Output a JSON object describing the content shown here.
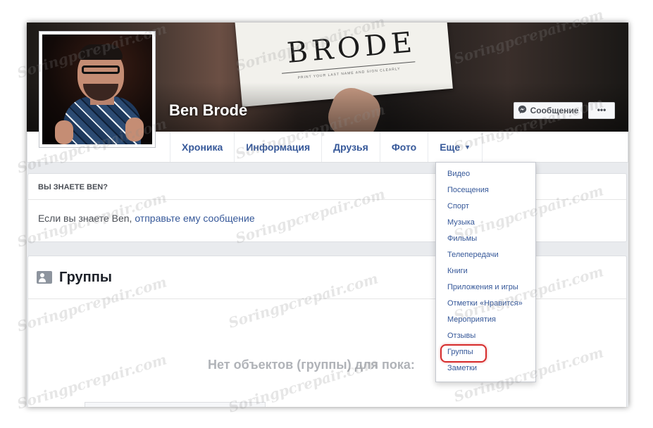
{
  "cover": {
    "sign_text": "BRODE",
    "sign_hint": "PRINT YOUR LAST NAME AND SIGN CLEARLY"
  },
  "profile": {
    "name": "Ben Brode"
  },
  "actions": {
    "message_label": "Сообщение",
    "more_label": "•••"
  },
  "tabs": [
    {
      "label": "Хроника"
    },
    {
      "label": "Информация"
    },
    {
      "label": "Друзья"
    },
    {
      "label": "Фото"
    },
    {
      "label": "Еще"
    }
  ],
  "know_card": {
    "header": "ВЫ ЗНАЕТЕ BEN?",
    "text_prefix": "Если вы знаете Ben, ",
    "link": "отправьте ему сообщение"
  },
  "groups_card": {
    "title": "Группы",
    "empty_text": "Нет объектов (группы) для пока:"
  },
  "dropdown": {
    "items": [
      "Видео",
      "Посещения",
      "Спорт",
      "Музыка",
      "Фильмы",
      "Телепередачи",
      "Книги",
      "Приложения и игры",
      "Отметки «Нравится»",
      "Мероприятия",
      "Отзывы",
      "Группы",
      "Заметки"
    ],
    "highlighted": "Группы"
  },
  "watermark": "Soringpcrepair.com",
  "colors": {
    "link": "#365899",
    "highlight": "#d62d2d",
    "page_bg": "#e9ebee"
  }
}
